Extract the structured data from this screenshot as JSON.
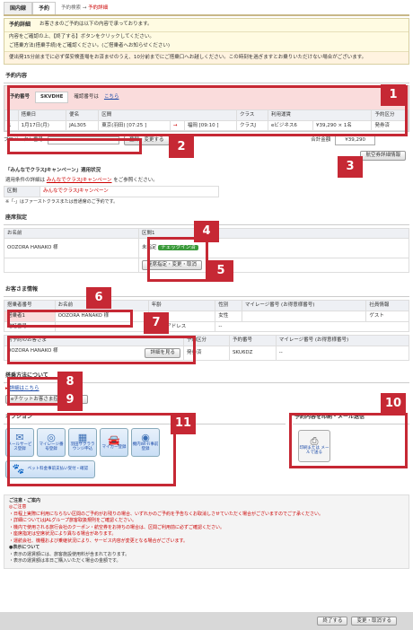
{
  "tabs": {
    "domestic": "国内線",
    "reservation": "予約"
  },
  "breadcrumb": {
    "prev": "予約検索",
    "arrow": "→",
    "current": "予約詳細"
  },
  "info": {
    "title": "予約詳細",
    "intro": "お客さまのご予約は以下の内容で承っております。",
    "line1": "内容をご確認の上、【終了する】ボタンをクリックしてください。",
    "line2": "ご搭乗方法(搭乗手続)をご確認ください。(ご搭乗者へお知らせください)",
    "warn": "便出発15分前までに必ず保安検査場をお済ませのうえ、10分前までにご搭乗口へお越しください。この時刻を過ぎますとお乗りいただけない場合がございます。"
  },
  "reservation": {
    "section_title": "予約内容",
    "no_label": "予約番号",
    "no_value": "SKVDHE",
    "confirm_label": "確認番号は",
    "confirm_link": "こちら",
    "headers": [
      "",
      "搭乗日",
      "便名",
      "区間",
      "",
      "",
      "クラス",
      "利用運賃",
      "",
      "予約区分"
    ],
    "row": [
      "1",
      "1月17日(月)",
      "JAL305",
      "東京(羽田) [07:25 ]",
      "→",
      "福岡 [09:10 ]",
      "クラスJ",
      "eビジネス6",
      "¥39,290 × 1名",
      "発券済"
    ]
  },
  "project": {
    "label": "プロジェクト番号",
    "button": "登録・変更する",
    "total_label": "合計金額",
    "total_value": "¥39,290",
    "ticket_button": "航空券詳細情報"
  },
  "campaign": {
    "title": "「みんなでクラスJキャンペーン」適用状況",
    "applicable": "適用条件の詳細は",
    "link": "みんなでクラスJキャンペーン",
    "suffix": "をご参照ください。",
    "kukan_label": "区間",
    "kukan_value": "みんなでクラスJキャンペーン",
    "note": "※「-」はファーストクラスまたは普通席のご予約です。"
  },
  "seat": {
    "section_title": "座席指定",
    "name_header": "お名前",
    "name_value": "OOZORA HANAKO 様",
    "kukan_header": "区間1",
    "status": "未指定",
    "checkin": "チェックイン済",
    "button": "座席指定・変更・取消"
  },
  "customer": {
    "section_title": "お客さま情報",
    "headers": [
      "搭乗者番号",
      "お名前",
      "年齢",
      "性別",
      "マイレージ番号 (お得意様番号)",
      "社員情報"
    ],
    "row": [
      "搭乗者1",
      "OOZORA HANAKO 様",
      "30歳",
      "女性",
      "",
      "ゲスト"
    ],
    "phone_label": "電話番号",
    "mail_label": "メールアドレス",
    "mail_value": "--",
    "other_label": "別予約のお客さま",
    "other_name": "OOZORA HANAKO 様",
    "detail_button": "詳細を見る",
    "other_headers": [
      "予約区分",
      "予約番号",
      "マイレージ番号 (お得意様番号)"
    ],
    "other_row": [
      "発券済",
      "SKU6DZ",
      "--"
    ]
  },
  "boarding": {
    "section_title": "搭乗方法について",
    "link": "詳細はこちら",
    "button": "eチケットお客さま控を発行する"
  },
  "options": {
    "section_title": "オプション",
    "items": [
      {
        "icon": "mail-icon",
        "glyph": "✉",
        "label": "メールサービス登録"
      },
      {
        "icon": "mileage-icon",
        "glyph": "◎",
        "label": "マイレージ番号登録"
      },
      {
        "icon": "lounge-icon",
        "glyph": "▦",
        "label": "羽田サクララウンジ申込"
      },
      {
        "icon": "car-icon",
        "glyph": "🚘",
        "label": "マイカー登録"
      },
      {
        "icon": "wifi-icon",
        "glyph": "◉",
        "label": "機内Wi-Fi事前登録"
      }
    ],
    "pet": {
      "glyph": "🐾",
      "label": "ペット料金事前支払い受付・確認"
    }
  },
  "print": {
    "section_title": "予約内容を印刷・メール送信",
    "label": "印刷または メールで送る"
  },
  "notes": {
    "title": "ご注意・ご案内",
    "sub": "◎ご注意",
    "items": [
      "・日程上実際に利用にならない区間のご予約がお残りの場合、いずれかのご予約を予告なくお取消しさせていただく場合がございますのでご了承ください。",
      "・詳細についてはJALグループ旅客取扱規則をご確認ください。",
      "・機内で使用される旅行会社のクーポン・航空券をお持ちの場合は、区間ご利用前に必ずご確認ください。",
      "・座席指定は空席状況により異なる場合があります。",
      "・運航会社、機種および乗継状況により、サービス内容が変更となる場合がございます。"
    ],
    "sub2": "●表示について",
    "items2": [
      "・表示の運賃額には、旅客施設使用料が含まれております。",
      "・表示の運賃額は本日ご購入いただく場合の金額です。"
    ]
  },
  "footer": {
    "end_button": "終了する",
    "change_button": "変更・取消する"
  },
  "badges": [
    "1",
    "2",
    "3",
    "4",
    "5",
    "6",
    "7",
    "8",
    "9",
    "10",
    "11"
  ]
}
